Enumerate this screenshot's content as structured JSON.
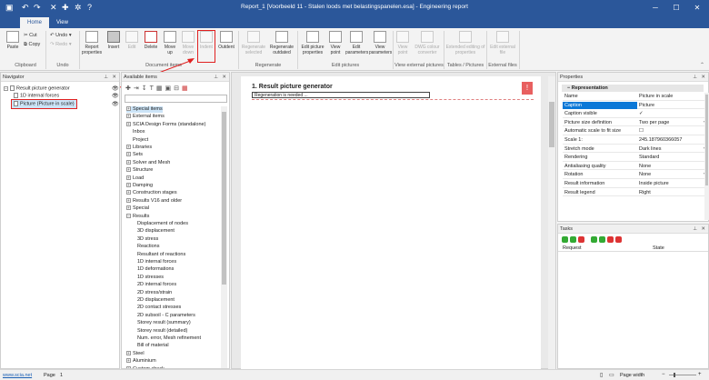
{
  "window": {
    "title": "Report_1 [Voorbeeld 11 - Stalen loods met belastingspanelen.esa] - Engineering report"
  },
  "tabs": [
    {
      "label": "Home"
    },
    {
      "label": "View"
    }
  ],
  "quick_access": {
    "undo_icon": "undo-icon",
    "redo_icon": "redo-icon",
    "close_icon": "close-icon",
    "add_icon": "add-icon",
    "settings_icon": "gear-icon",
    "help_icon": "help-icon"
  },
  "ribbon": {
    "paste": "Paste",
    "cut": "Cut",
    "copy": "Copy",
    "undo": "Undo",
    "redo": "Redo",
    "report_properties": "Report properties",
    "insert": "Insert",
    "edit": "Edit",
    "delete": "Delete",
    "move_up": "Move up",
    "move_down": "Move down",
    "indent": "Indent",
    "outdent": "Outdent",
    "regen_selected": "Regenerate selected",
    "regen_outdated": "Regenerate outdated",
    "edit_picture_properties": "Edit picture properties",
    "view_point": "View point",
    "edit_parameters": "Edit parameters",
    "view_parameters": "View parameters",
    "view_point_ext": "View point",
    "dwg_converter": "DWG colour converter",
    "extended_editing": "Extended editing of properties",
    "edit_external_file": "Edit external file",
    "groups": {
      "clipboard": "Clipboard",
      "undo": "Undo",
      "document_items": "Document items",
      "regenerate": "Regenerate",
      "edit_pictures": "Edit pictures",
      "view_external_pictures": "View external pictures",
      "tables_pictures": "Tables / Pictures",
      "external_files": "External files"
    }
  },
  "navigator": {
    "title": "Navigator",
    "items": [
      {
        "label": "Result picture generator"
      },
      {
        "label": "1D internal forces"
      },
      {
        "label": "Picture (Picture in scale)"
      }
    ]
  },
  "available": {
    "title": "Available items",
    "search_placeholder": "",
    "items": [
      {
        "label": "Special items",
        "expander": "+"
      },
      {
        "label": "External items",
        "expander": "+"
      },
      {
        "label": "SCIA Design Forms (standalone)",
        "expander": "+"
      },
      {
        "label": "Inbox",
        "expander": ""
      },
      {
        "label": "Project",
        "expander": ""
      },
      {
        "label": "Libraries",
        "expander": "+"
      },
      {
        "label": "Sets",
        "expander": "+"
      },
      {
        "label": "Solver and Mesh",
        "expander": "+"
      },
      {
        "label": "Structure",
        "expander": "+"
      },
      {
        "label": "Load",
        "expander": "+"
      },
      {
        "label": "Damping",
        "expander": "+"
      },
      {
        "label": "Construction stages",
        "expander": "+"
      },
      {
        "label": "Results V16 and older",
        "expander": "+"
      },
      {
        "label": "Special",
        "expander": "+"
      },
      {
        "label": "Results",
        "expander": "−"
      }
    ],
    "results_children": [
      "Displacement of nodes",
      "3D displacement",
      "3D stress",
      "Reactions",
      "Resultant of reactions",
      "1D internal forces",
      "1D deformations",
      "1D stresses",
      "2D internal forces",
      "2D stress/strain",
      "2D displacement",
      "2D contact stresses",
      "2D subsoil - C parameters",
      "Storey result (summary)",
      "Storey result (detailed)",
      "Num. error, Mesh refinement",
      "Bill of material"
    ],
    "tail_items": [
      {
        "label": "Steel",
        "expander": "+"
      },
      {
        "label": "Aluminium",
        "expander": "+"
      },
      {
        "label": "Custom check",
        "expander": "+"
      }
    ]
  },
  "document": {
    "heading": "1. Result picture generator",
    "regen_text": "Regeneration is needed ...",
    "warning_icon": "warning-icon"
  },
  "properties": {
    "title": "Properties",
    "section": "Representation",
    "rows": [
      {
        "key": "Name",
        "value": "Picture in scale"
      },
      {
        "key": "Caption",
        "value": "Picture"
      },
      {
        "key": "Caption visible",
        "value": "✓"
      },
      {
        "key": "Picture size definition",
        "value": "Two per page"
      },
      {
        "key": "Automatic scale to fit size",
        "value": "☐"
      },
      {
        "key": "Scale 1:",
        "value": "245.187960366057"
      },
      {
        "key": "Stretch mode",
        "value": "Dark lines"
      },
      {
        "key": "Rendering",
        "value": "Standard"
      },
      {
        "key": "Antialiasing quality",
        "value": "None"
      },
      {
        "key": "Rotation",
        "value": "None"
      },
      {
        "key": "Result information",
        "value": "Inside picture"
      },
      {
        "key": "Result legend",
        "value": "Right"
      }
    ]
  },
  "tasks": {
    "title": "Tasks",
    "col_request": "Request",
    "col_state": "State"
  },
  "status": {
    "link": "www.scia.net",
    "page_label": "Page",
    "page_number": "1",
    "page_width": "Page width"
  },
  "colors": {
    "accent": "#2b579a",
    "selection": "#0b78d7",
    "highlight": "#e02020"
  }
}
